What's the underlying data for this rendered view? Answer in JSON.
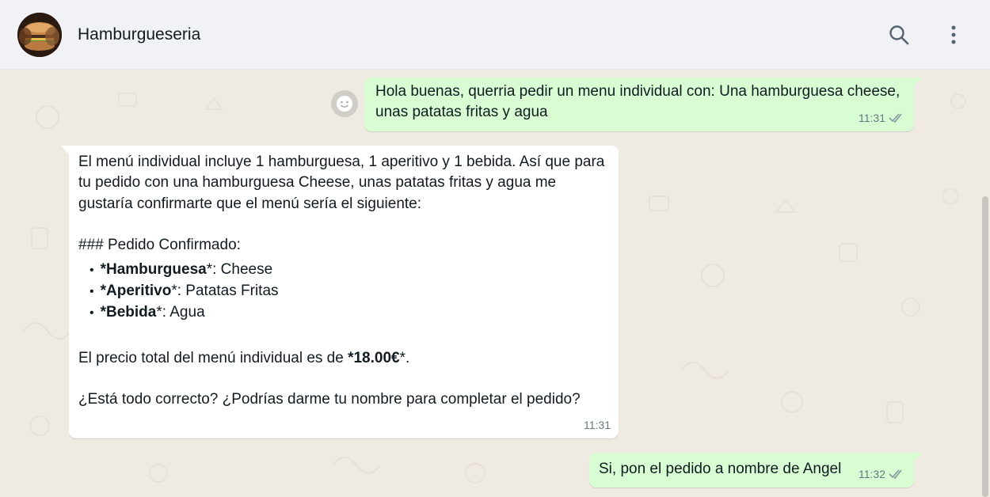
{
  "header": {
    "chat_name": "Hamburgueseria",
    "search_icon": "search-icon",
    "menu_icon": "kebab-menu-icon"
  },
  "messages": [
    {
      "direction": "outgoing",
      "text": "Hola buenas, querria pedir un menu individual con: Una hamburguesa cheese, unas patatas fritas y agua",
      "time": "11:31",
      "status": "read"
    },
    {
      "direction": "incoming",
      "intro": "El menú individual incluye 1 hamburguesa, 1 aperitivo y 1 bebida. Así que para tu pedido con una hamburguesa Cheese, unas patatas fritas y agua me gustaría confirmarte que el menú sería el siguiente:",
      "heading": "### Pedido Confirmado:",
      "items": [
        {
          "label": "*Hamburguesa",
          "suffix": "*: Cheese"
        },
        {
          "label": "*Aperitivo",
          "suffix": "*: Patatas Fritas"
        },
        {
          "label": "*Bebida",
          "suffix": "*: Agua"
        }
      ],
      "price_prefix": "El precio total del menú individual es de ",
      "price_value": "*18.00€",
      "price_suffix": "*.",
      "question": "¿Está todo correcto? ¿Podrías darme tu nombre para completar el pedido?",
      "time": "11:31"
    },
    {
      "direction": "outgoing",
      "text": "Si, pon el pedido a nombre de Angel",
      "time": "11:32",
      "status": "read"
    }
  ],
  "colors": {
    "header_bg": "#f0f2f5",
    "chat_bg": "#efeae2",
    "outgoing_bubble": "#d9fdd3",
    "incoming_bubble": "#ffffff",
    "read_tick": "#8696a0"
  }
}
